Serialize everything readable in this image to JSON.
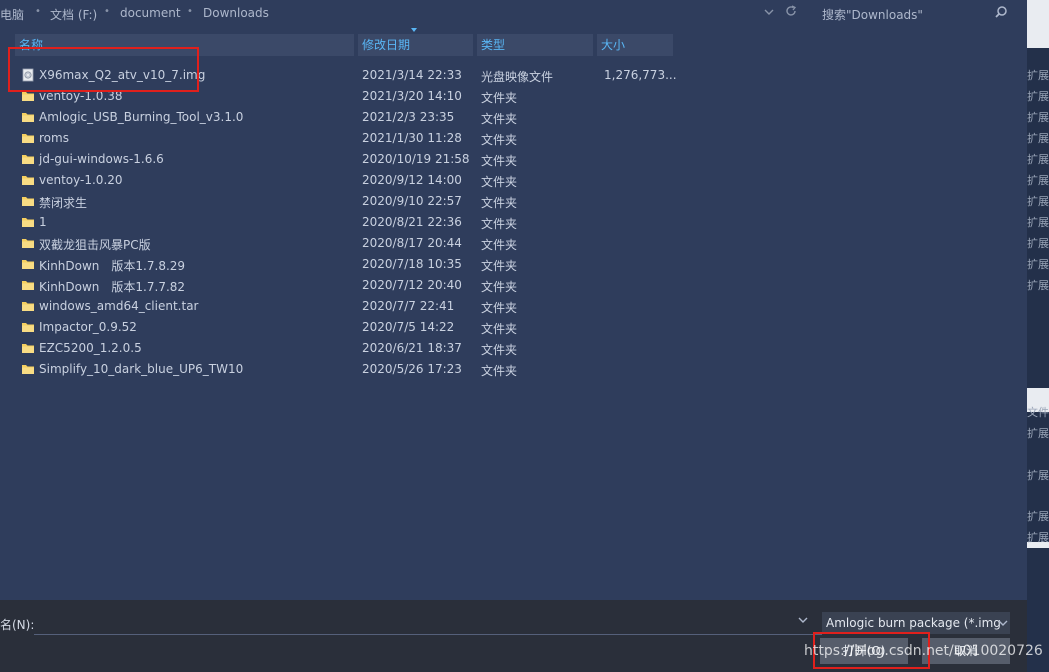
{
  "breadcrumb": {
    "items": [
      "电脑",
      "文档 (F:)",
      "document",
      "Downloads"
    ]
  },
  "search": {
    "placeholder": "搜索\"Downloads\""
  },
  "columns": [
    "名称",
    "修改日期",
    "类型",
    "大小"
  ],
  "files": [
    {
      "name": "X96max_Q2_atv_v10_7.img",
      "date": "2021/3/14 22:33",
      "type": "光盘映像文件",
      "size": "1,276,773...",
      "icon": "disc-image-icon"
    },
    {
      "name": "ventoy-1.0.38",
      "date": "2021/3/20 14:10",
      "type": "文件夹",
      "size": "",
      "icon": "folder-icon"
    },
    {
      "name": "Amlogic_USB_Burning_Tool_v3.1.0",
      "date": "2021/2/3 23:35",
      "type": "文件夹",
      "size": "",
      "icon": "folder-icon"
    },
    {
      "name": "roms",
      "date": "2021/1/30 11:28",
      "type": "文件夹",
      "size": "",
      "icon": "folder-icon"
    },
    {
      "name": "jd-gui-windows-1.6.6",
      "date": "2020/10/19 21:58",
      "type": "文件夹",
      "size": "",
      "icon": "folder-icon"
    },
    {
      "name": "ventoy-1.0.20",
      "date": "2020/9/12 14:00",
      "type": "文件夹",
      "size": "",
      "icon": "folder-icon"
    },
    {
      "name": "禁闭求生",
      "date": "2020/9/10 22:57",
      "type": "文件夹",
      "size": "",
      "icon": "folder-icon"
    },
    {
      "name": "1",
      "date": "2020/8/21 22:36",
      "type": "文件夹",
      "size": "",
      "icon": "folder-icon"
    },
    {
      "name": "双截龙狙击风暴PC版",
      "date": "2020/8/17 20:44",
      "type": "文件夹",
      "size": "",
      "icon": "folder-icon"
    },
    {
      "name": "KinhDown　版本1.7.8.29",
      "date": "2020/7/18 10:35",
      "type": "文件夹",
      "size": "",
      "icon": "folder-icon"
    },
    {
      "name": "KinhDown　版本1.7.7.82",
      "date": "2020/7/12 20:40",
      "type": "文件夹",
      "size": "",
      "icon": "folder-icon"
    },
    {
      "name": "windows_amd64_client.tar",
      "date": "2020/7/7 22:41",
      "type": "文件夹",
      "size": "",
      "icon": "folder-icon"
    },
    {
      "name": "Impactor_0.9.52",
      "date": "2020/7/5 14:22",
      "type": "文件夹",
      "size": "",
      "icon": "folder-icon"
    },
    {
      "name": "EZC5200_1.2.0.5",
      "date": "2020/6/21 18:37",
      "type": "文件夹",
      "size": "",
      "icon": "folder-icon"
    },
    {
      "name": "Simplify_10_dark_blue_UP6_TW10",
      "date": "2020/5/26 17:23",
      "type": "文件夹",
      "size": "",
      "icon": "folder-icon"
    }
  ],
  "right_pane": {
    "items": [
      "扩展",
      "扩展",
      "扩展",
      "扩展",
      "扩展",
      "扩展",
      "扩展",
      "扩展",
      "扩展",
      "扩展",
      "扩展",
      "文件",
      "扩展",
      "扩展",
      "扩展",
      "扩展"
    ]
  },
  "bottom": {
    "filename_label": "名(N):",
    "filename_value": "",
    "filter_value": "Amlogic burn package (*.img",
    "open_label": "打开(O)",
    "cancel_label": "取消"
  },
  "watermark": "https://blog.csdn.net/u010020726",
  "colors": {
    "background": "#2f3d5c",
    "header_text": "#59b6f5",
    "highlight_box": "#e0201c",
    "folder": "#f5cf60"
  }
}
